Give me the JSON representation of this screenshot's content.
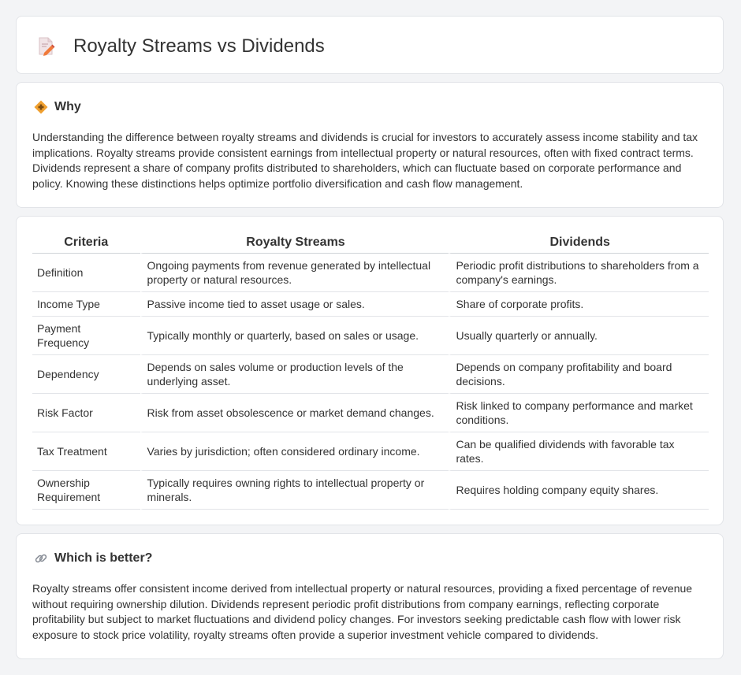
{
  "header": {
    "title": "Royalty Streams vs Dividends",
    "icon": "document-pencil-icon"
  },
  "why": {
    "title": "Why",
    "icon": "diamond-sign-icon",
    "body": "Understanding the difference between royalty streams and dividends is crucial for investors to accurately assess income stability and tax implications. Royalty streams provide consistent earnings from intellectual property or natural resources, often with fixed contract terms. Dividends represent a share of company profits distributed to shareholders, which can fluctuate based on corporate performance and policy. Knowing these distinctions helps optimize portfolio diversification and cash flow management."
  },
  "table": {
    "headers": [
      "Criteria",
      "Royalty Streams",
      "Dividends"
    ],
    "rows": [
      [
        "Definition",
        "Ongoing payments from revenue generated by intellectual property or natural resources.",
        "Periodic profit distributions to shareholders from a company's earnings."
      ],
      [
        "Income Type",
        "Passive income tied to asset usage or sales.",
        "Share of corporate profits."
      ],
      [
        "Payment Frequency",
        "Typically monthly or quarterly, based on sales or usage.",
        "Usually quarterly or annually."
      ],
      [
        "Dependency",
        "Depends on sales volume or production levels of the underlying asset.",
        "Depends on company profitability and board decisions."
      ],
      [
        "Risk Factor",
        "Risk from asset obsolescence or market demand changes.",
        "Risk linked to company performance and market conditions."
      ],
      [
        "Tax Treatment",
        "Varies by jurisdiction; often considered ordinary income.",
        "Can be qualified dividends with favorable tax rates."
      ],
      [
        "Ownership Requirement",
        "Typically requires owning rights to intellectual property or minerals.",
        "Requires holding company equity shares."
      ]
    ]
  },
  "better": {
    "title": "Which is better?",
    "icon": "link-icon",
    "body": "Royalty streams offer consistent income derived from intellectual property or natural resources, providing a fixed percentage of revenue without requiring ownership dilution. Dividends represent periodic profit distributions from company earnings, reflecting corporate profitability but subject to market fluctuations and dividend policy changes. For investors seeking predictable cash flow with lower risk exposure to stock price volatility, royalty streams often provide a superior investment vehicle compared to dividends."
  },
  "colors": {
    "background": "#f3f4f6",
    "card": "#ffffff",
    "text": "#333333",
    "accent": "#f0a030"
  }
}
